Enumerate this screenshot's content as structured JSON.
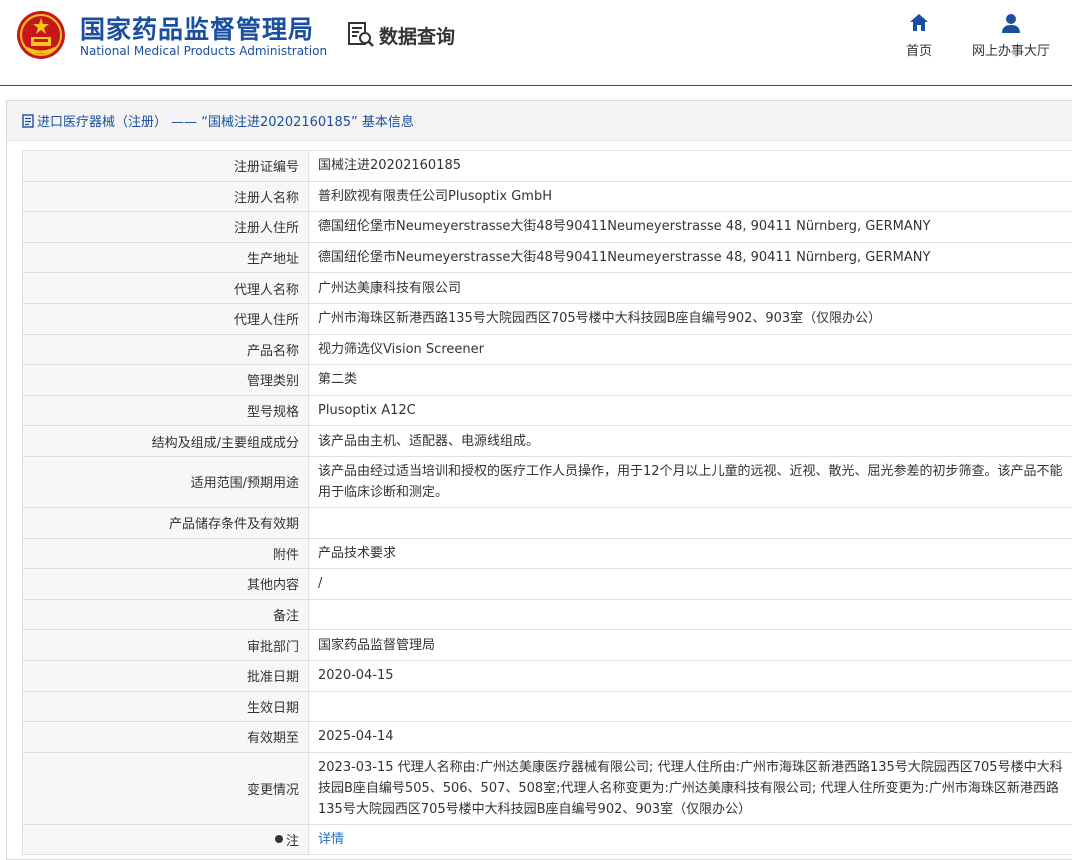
{
  "header": {
    "brand_cn": "国家药品监督管理局",
    "brand_en": "National Medical Products Administration",
    "query_title": "数据查询",
    "nav": [
      {
        "label": "首页",
        "icon": "home-icon"
      },
      {
        "label": "网上办事大厅",
        "icon": "user-icon"
      }
    ]
  },
  "panel": {
    "title": "进口医疗器械（注册） —— “国械注进20202160185” 基本信息"
  },
  "rows": [
    {
      "label": "注册证编号",
      "value": "国械注进20202160185"
    },
    {
      "label": "注册人名称",
      "value": "普利欧视有限责任公司Plusoptix GmbH"
    },
    {
      "label": "注册人住所",
      "value": "德国纽伦堡市Neumeyerstrasse大街48号90411Neumeyerstrasse 48, 90411 Nürnberg, GERMANY"
    },
    {
      "label": "生产地址",
      "value": "德国纽伦堡市Neumeyerstrasse大街48号90411Neumeyerstrasse 48, 90411 Nürnberg, GERMANY"
    },
    {
      "label": "代理人名称",
      "value": "广州达美康科技有限公司"
    },
    {
      "label": "代理人住所",
      "value": "广州市海珠区新港西路135号大院园西区705号楼中大科技园B座自编号902、903室（仅限办公）"
    },
    {
      "label": "产品名称",
      "value": "视力筛选仪Vision Screener"
    },
    {
      "label": "管理类别",
      "value": "第二类"
    },
    {
      "label": "型号规格",
      "value": "Plusoptix A12C"
    },
    {
      "label": "结构及组成/主要组成成分",
      "value": "该产品由主机、适配器、电源线组成。"
    },
    {
      "label": "适用范围/预期用途",
      "value": "该产品由经过适当培训和授权的医疗工作人员操作，用于12个月以上儿童的远视、近视、散光、屈光参差的初步筛查。该产品不能用于临床诊断和测定。"
    },
    {
      "label": "产品储存条件及有效期",
      "value": ""
    },
    {
      "label": "附件",
      "value": "产品技术要求"
    },
    {
      "label": "其他内容",
      "value": "/"
    },
    {
      "label": "备注",
      "value": ""
    },
    {
      "label": "审批部门",
      "value": "国家药品监督管理局"
    },
    {
      "label": "批准日期",
      "value": "2020-04-15"
    },
    {
      "label": "生效日期",
      "value": ""
    },
    {
      "label": "有效期至",
      "value": "2025-04-14"
    },
    {
      "label": "变更情况",
      "value": "2023-03-15 代理人名称由:广州达美康医疗器械有限公司; 代理人住所由:广州市海珠区新港西路135号大院园西区705号楼中大科技园B座自编号505、506、507、508室;代理人名称变更为:广州达美康科技有限公司; 代理人住所变更为:广州市海珠区新港西路135号大院园西区705号楼中大科技园B座自编号902、903室（仅限办公）"
    },
    {
      "label": "注",
      "value": "详情"
    }
  ],
  "colors": {
    "brand_blue": "#1a4fa0",
    "link_blue": "#1a6fd0",
    "label_bg": "#f7f7f7",
    "border": "#e0e0e0"
  }
}
